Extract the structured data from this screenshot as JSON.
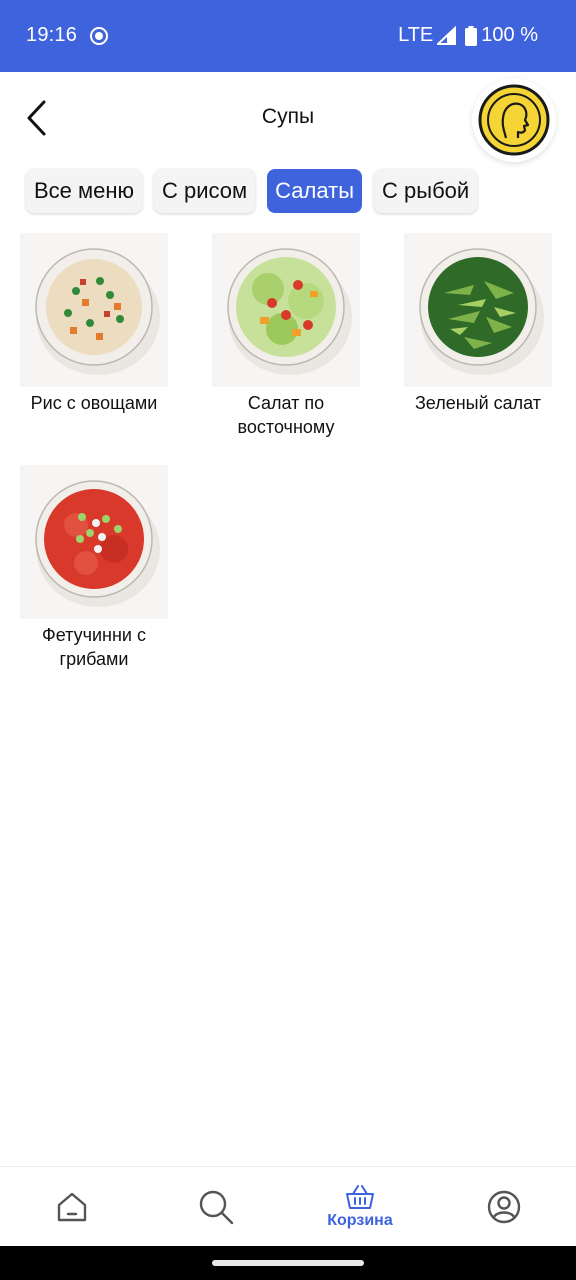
{
  "status_bar": {
    "time": "19:16",
    "network": "LTE",
    "battery": "100 %"
  },
  "header": {
    "title": "Супы"
  },
  "tabs": [
    {
      "label": "Все меню",
      "active": false
    },
    {
      "label": "С рисом",
      "active": false
    },
    {
      "label": "Салаты",
      "active": true
    },
    {
      "label": "С рыбой",
      "active": false
    }
  ],
  "products": [
    {
      "name": "Рис с овощами"
    },
    {
      "name": "Салат по восточному"
    },
    {
      "name": "Зеленый салат"
    },
    {
      "name": "Фетучинни с грибами"
    }
  ],
  "bottom_nav": {
    "cart_label": "Корзина"
  },
  "colors": {
    "accent": "#3f63dd",
    "coin": "#f5d435"
  }
}
